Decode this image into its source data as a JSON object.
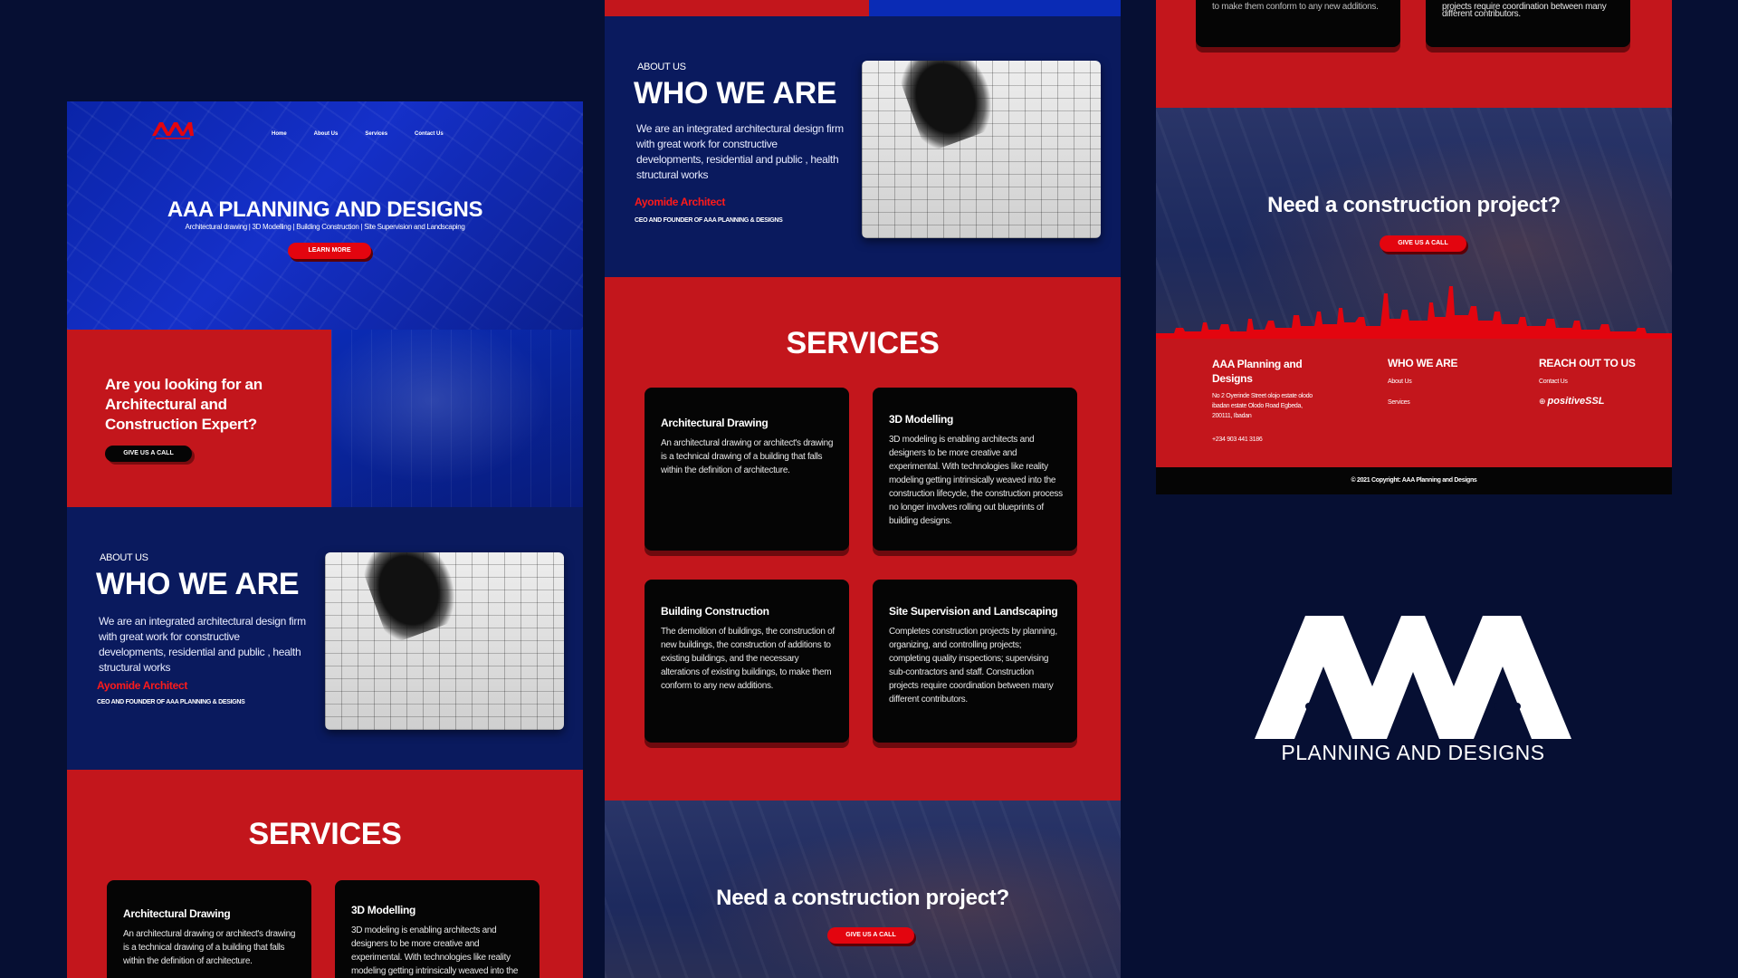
{
  "brand": {
    "name": "AAA PLANNING AND DESIGNS",
    "logo_letters": "AAA",
    "logo_tagline": "PLANNING AND DESIGNS"
  },
  "nav": {
    "home": "Home",
    "about": "About Us",
    "services": "Services",
    "contact": "Contact Us"
  },
  "hero": {
    "title": "AAA PLANNING AND DESIGNS",
    "subtitle": "Architectural drawing | 3D Modelling | Building Construction | Site Supervision and Landscaping",
    "button": "LEARN MORE"
  },
  "looking": {
    "question": "Are you looking for an Architectural and Construction Expert?",
    "button": "GIVE US A CALL"
  },
  "about": {
    "eyebrow": "ABOUT US",
    "title": "WHO WE ARE",
    "description": "We are an integrated architectural design firm with great work for constructive developments, residential and public , health structural works",
    "name": "Ayomide Architect",
    "role": "CEO AND FOUNDER OF AAA PLANNING & DESIGNS"
  },
  "services": {
    "title": "SERVICES",
    "items": [
      {
        "title": "Architectural Drawing",
        "text": "An architectural drawing or architect's drawing is a technical drawing of a building that falls within the definition of architecture."
      },
      {
        "title": "3D Modelling",
        "text": "3D modeling is enabling architects and designers to be more creative and experimental. With technologies like reality modeling getting intrinsically weaved into the construction lifecycle, the construction process no longer involves rolling out blueprints of building designs."
      },
      {
        "title": "Building Construction",
        "text": "The demolition of buildings, the construction of new buildings, the construction of additions to existing buildings, and the necessary alterations of existing buildings, to make them conform to any new additions."
      },
      {
        "title": "Site Supervision and Landscaping",
        "text": "Completes construction projects by planning, organizing, and controlling projects; completing quality inspections; supervising sub-contractors and staff. Construction projects require coordination between many different contributors."
      }
    ]
  },
  "cta": {
    "title": "Need a construction project?",
    "button": "GIVE US A CALL"
  },
  "footer": {
    "company": "AAA Planning and Designs",
    "address": "No 2 Oyerinde Street olojo estate olodo ibadan estate Olodo Road Egbeda, 200111, Ibadan",
    "phone": "+234 903 441 3186",
    "who_heading": "WHO WE ARE",
    "who_links": [
      "About Us",
      "Services"
    ],
    "reach_heading": "REACH OUT TO US",
    "reach_links": [
      "Contact Us"
    ],
    "badge": "positiveSSL",
    "copyright": "© 2021 Copyright: AAA Planning and Designs"
  },
  "col2_top": {
    "card_tail_left": "",
    "card_tail_right": ""
  },
  "col3_top": {
    "card_tail_left": "to make them conform to any new additions.",
    "card_tail_right_1": "projects require coordination between many",
    "card_tail_right_2": "different contributors."
  },
  "colors": {
    "navy": "#060f33",
    "red": "#c3161c",
    "blue": "#0a24a8",
    "accent_red": "#e3050f"
  }
}
